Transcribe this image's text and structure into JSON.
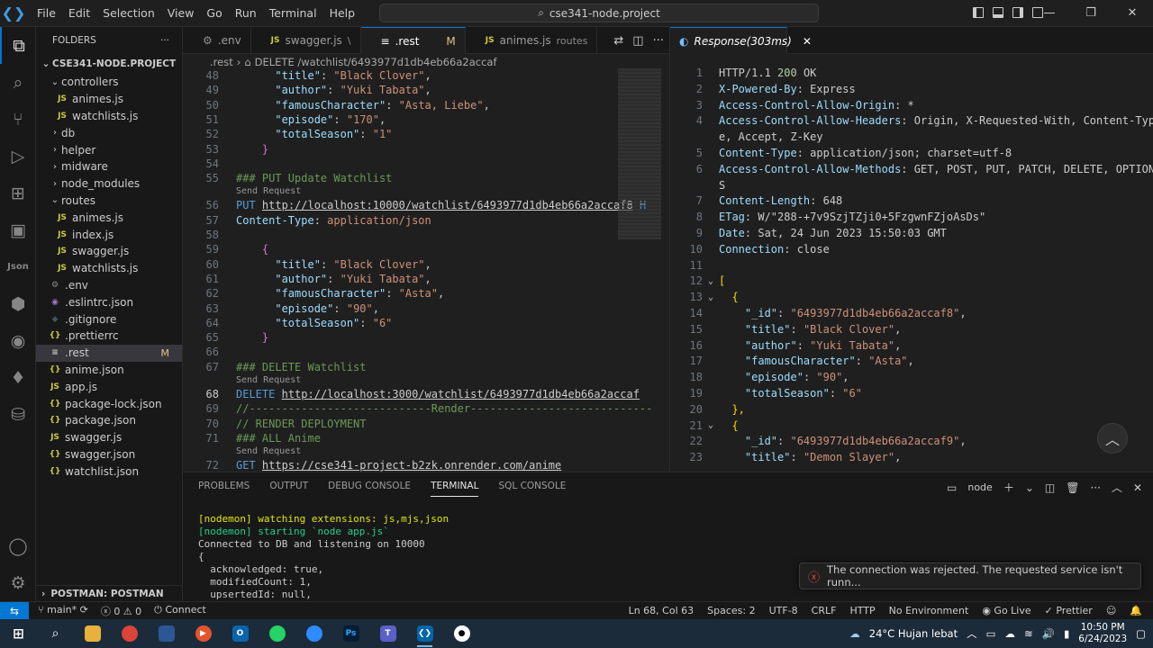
{
  "titlebar": {
    "menu": [
      "File",
      "Edit",
      "Selection",
      "View",
      "Go",
      "Run",
      "Terminal",
      "Help"
    ],
    "search_text": "cse341-node.project"
  },
  "explorer": {
    "header": "FOLDERS",
    "root": "CSE341-NODE.PROJECT",
    "items": [
      {
        "label": "controllers",
        "kind": "folder-open",
        "indent": 1
      },
      {
        "label": "animes.js",
        "kind": "js",
        "indent": 2
      },
      {
        "label": "watchlists.js",
        "kind": "js",
        "indent": 2
      },
      {
        "label": "db",
        "kind": "folder",
        "indent": 1
      },
      {
        "label": "helper",
        "kind": "folder",
        "indent": 1
      },
      {
        "label": "midware",
        "kind": "folder",
        "indent": 1
      },
      {
        "label": "node_modules",
        "kind": "folder",
        "indent": 1
      },
      {
        "label": "routes",
        "kind": "folder-open",
        "indent": 1
      },
      {
        "label": "animes.js",
        "kind": "js",
        "indent": 2
      },
      {
        "label": "index.js",
        "kind": "js",
        "indent": 2
      },
      {
        "label": "swagger.js",
        "kind": "js",
        "indent": 2
      },
      {
        "label": "watchlists.js",
        "kind": "js",
        "indent": 2
      },
      {
        "label": ".env",
        "kind": "gear",
        "indent": 1
      },
      {
        "label": ".eslintrc.json",
        "kind": "eslint",
        "indent": 1
      },
      {
        "label": ".gitignore",
        "kind": "git",
        "indent": 1
      },
      {
        "label": ".prettierrc",
        "kind": "json",
        "indent": 1
      },
      {
        "label": ".rest",
        "kind": "rest",
        "indent": 1,
        "selected": true,
        "badge": "M"
      },
      {
        "label": "anime.json",
        "kind": "json",
        "indent": 1
      },
      {
        "label": "app.js",
        "kind": "js",
        "indent": 1
      },
      {
        "label": "package-lock.json",
        "kind": "json",
        "indent": 1
      },
      {
        "label": "package.json",
        "kind": "json",
        "indent": 1
      },
      {
        "label": "swagger.js",
        "kind": "js",
        "indent": 1
      },
      {
        "label": "swagger.json",
        "kind": "json",
        "indent": 1
      },
      {
        "label": "watchlist.json",
        "kind": "json",
        "indent": 1
      }
    ],
    "postman": "POSTMAN: POSTMAN"
  },
  "tabs": [
    {
      "label": ".env",
      "icon": "⚙",
      "desc": ""
    },
    {
      "label": "swagger.js",
      "icon": "JS",
      "desc": "\\"
    },
    {
      "label": ".rest",
      "icon": "≡",
      "desc": "",
      "active": true,
      "mod": "M"
    },
    {
      "label": "animes.js",
      "icon": "JS",
      "desc": "routes"
    }
  ],
  "breadcrumb": {
    "file": ".rest",
    "path": "DELETE /watchlist/6493977d1db4eb66a2accaf"
  },
  "editor": {
    "lines": [
      {
        "n": "48",
        "t": "      \"title\": \"Black Clover\","
      },
      {
        "n": "49",
        "t": "      \"author\": \"Yuki Tabata\","
      },
      {
        "n": "50",
        "t": "      \"famousCharacter\": \"Asta, Liebe\","
      },
      {
        "n": "51",
        "t": "      \"episode\": \"170\","
      },
      {
        "n": "52",
        "t": "      \"totalSeason\": \"1\""
      },
      {
        "n": "53",
        "t": "    }"
      },
      {
        "n": "54",
        "t": ""
      },
      {
        "n": "55",
        "t": "### PUT Update Watchlist"
      },
      {
        "n": "56",
        "t": "PUT http://localhost:10000/watchlist/6493977d1db4eb66a2accaf8 H"
      },
      {
        "n": "57",
        "t": "Content-Type: application/json"
      },
      {
        "n": "58",
        "t": ""
      },
      {
        "n": "59",
        "t": "    {"
      },
      {
        "n": "60",
        "t": "      \"title\": \"Black Clover\","
      },
      {
        "n": "61",
        "t": "      \"author\": \"Yuki Tabata\","
      },
      {
        "n": "62",
        "t": "      \"famousCharacter\": \"Asta\","
      },
      {
        "n": "63",
        "t": "      \"episode\": \"90\","
      },
      {
        "n": "64",
        "t": "      \"totalSeason\": \"6\""
      },
      {
        "n": "65",
        "t": "    }"
      },
      {
        "n": "66",
        "t": ""
      },
      {
        "n": "67",
        "t": "### DELETE Watchlist"
      },
      {
        "n": "68",
        "t": "DELETE http://localhost:3000/watchlist/6493977d1db4eb66a2accaf"
      },
      {
        "n": "69",
        "t": "//----------------------------Render----------------------------"
      },
      {
        "n": "70",
        "t": "// RENDER DEPLOYMENT"
      },
      {
        "n": "71",
        "t": "### ALL Anime"
      },
      {
        "n": "72",
        "t": "GET https://cse341-project-b2zk.onrender.com/anime"
      }
    ],
    "codelens": "Send Request"
  },
  "response": {
    "tab_label": "Response(303ms)",
    "lines": [
      {
        "n": "1",
        "t": "HTTP/1.1 200 OK"
      },
      {
        "n": "2",
        "t": "X-Powered-By: Express"
      },
      {
        "n": "3",
        "t": "Access-Control-Allow-Origin: *"
      },
      {
        "n": "4",
        "t": "Access-Control-Allow-Headers: Origin, X-Requested-With, Content-Typ"
      },
      {
        "n": "",
        "t": "e, Accept, Z-Key"
      },
      {
        "n": "5",
        "t": "Content-Type: application/json; charset=utf-8"
      },
      {
        "n": "6",
        "t": "Access-Control-Allow-Methods: GET, POST, PUT, PATCH, DELETE, OPTION"
      },
      {
        "n": "",
        "t": "S"
      },
      {
        "n": "7",
        "t": "Content-Length: 648"
      },
      {
        "n": "8",
        "t": "ETag: W/\"288-+7v9SzjTZji0+5FzgwnFZjoAsDs\""
      },
      {
        "n": "9",
        "t": "Date: Sat, 24 Jun 2023 15:50:03 GMT"
      },
      {
        "n": "10",
        "t": "Connection: close"
      },
      {
        "n": "11",
        "t": ""
      },
      {
        "n": "12",
        "t": "[",
        "fold": true
      },
      {
        "n": "13",
        "t": "  {",
        "fold": true
      },
      {
        "n": "14",
        "t": "    \"_id\": \"6493977d1db4eb66a2accaf8\","
      },
      {
        "n": "15",
        "t": "    \"title\": \"Black Clover\","
      },
      {
        "n": "16",
        "t": "    \"author\": \"Yuki Tabata\","
      },
      {
        "n": "17",
        "t": "    \"famousCharacter\": \"Asta\","
      },
      {
        "n": "18",
        "t": "    \"episode\": \"90\","
      },
      {
        "n": "19",
        "t": "    \"totalSeason\": \"6\""
      },
      {
        "n": "20",
        "t": "  },"
      },
      {
        "n": "21",
        "t": "  {",
        "fold": true
      },
      {
        "n": "22",
        "t": "    \"_id\": \"6493977d1db4eb66a2accaf9\","
      },
      {
        "n": "23",
        "t": "    \"title\": \"Demon Slayer\","
      }
    ]
  },
  "panel": {
    "tabs": [
      "PROBLEMS",
      "OUTPUT",
      "DEBUG CONSOLE",
      "TERMINAL",
      "SQL CONSOLE"
    ],
    "active_tab": "TERMINAL",
    "terminal_name": "node",
    "terminal": [
      "[nodemon] watching extensions: js,mjs,json",
      "[nodemon] starting `node app.js`",
      "Connected to DB and listening on 10000",
      "{",
      "  acknowledged: true,",
      "  modifiedCount: 1,",
      "  upsertedId: null,"
    ]
  },
  "notification": "The connection was rejected. The requested service isn't runn...",
  "statusbar": {
    "branch": "main*",
    "errors": "0",
    "warnings": "0",
    "connect": "Connect",
    "position": "Ln 68, Col 63",
    "spaces": "Spaces: 2",
    "encoding": "UTF-8",
    "eol": "CRLF",
    "language": "HTTP",
    "env": "No Environment",
    "golive": "Go Live",
    "prettier": "Prettier"
  },
  "taskbar": {
    "weather": "24°C  Hujan lebat",
    "time": "10:50 PM",
    "date": "6/24/2023"
  }
}
